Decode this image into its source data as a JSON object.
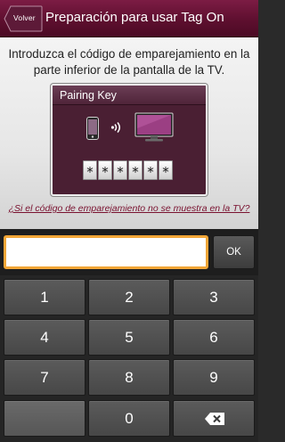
{
  "header": {
    "back_label": "Volver",
    "title": "Preparación para usar Tag On"
  },
  "instruction": "Introduzca el código de emparejamiento en la parte inferior de la pantalla de la TV.",
  "pairing_panel": {
    "title": "Pairing Key",
    "masked_digits": [
      "*",
      "*",
      "*",
      "*",
      "*",
      "*"
    ]
  },
  "help_link": "¿Si el código de emparejamiento no se muestra en la TV?",
  "code_input": {
    "value": "",
    "placeholder": ""
  },
  "ok_label": "OK",
  "keypad": {
    "keys": [
      "1",
      "2",
      "3",
      "4",
      "5",
      "6",
      "7",
      "8",
      "9",
      "",
      "0"
    ]
  },
  "colors": {
    "header": "#5e0f2f",
    "accent_border": "#f2a637",
    "link": "#7a1230"
  }
}
